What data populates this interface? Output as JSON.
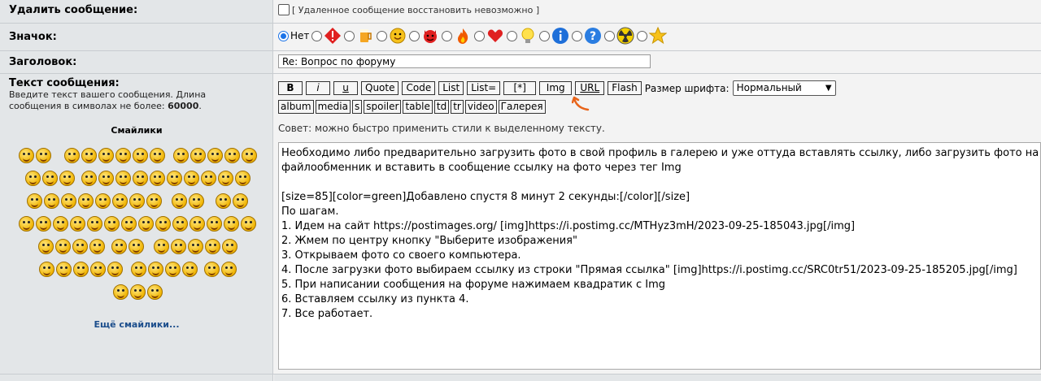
{
  "delete": {
    "label": "Удалить сообщение:",
    "note": "[ Удаленное сообщение восстановить невозможно ]"
  },
  "icon": {
    "label": "Значок:",
    "none_label": "Нет",
    "options": [
      "warning-icon",
      "beer-icon",
      "smile-icon",
      "devil-icon",
      "fire-icon",
      "heart-icon",
      "lightbulb-icon",
      "info-icon",
      "question-icon",
      "radioactive-icon",
      "star-icon"
    ]
  },
  "title": {
    "label": "Заголовок:",
    "value": "Re: Вопрос по форуму"
  },
  "message": {
    "label": "Текст сообщения:",
    "hint_prefix": "Введите текст вашего сообщения. Длина сообщения в символах не более: ",
    "hint_limit": "60000",
    "hint_suffix": ".",
    "smiles_title": "Смайлики",
    "more_smiles": "Ещё смайлики..."
  },
  "toolbar": {
    "row1": [
      "B",
      "i",
      "u",
      "Quote",
      "Code",
      "List",
      "List=",
      "[*]",
      "Img",
      "URL",
      "Flash"
    ],
    "font_size_label": "Размер шрифта:",
    "font_size_value": "Нормальный",
    "row2": [
      "album",
      "media",
      "s",
      "spoiler",
      "table",
      "td",
      "tr",
      "video",
      "Галерея"
    ]
  },
  "tip": "Совет: можно быстро применить стили к выделенному тексту.",
  "body_text": "Необходимо либо предварительно загрузить фото в свой профиль в галерею и уже оттуда вставлять ссылку, либо загрузить фото на л\nфайлообменник и вставить в сообщение ссылку на фото через тег Img\n\n[size=85][color=green]Добавлено спустя 8 минут 2 секунды:[/color][/size]\nПо шагам.\n1. Идем на сайт https://postimages.org/ [img]https://i.postimg.cc/MTHyz3mH/2023-09-25-185043.jpg[/img]\n2. Жмем по центру кнопку \"Выберите изображения\"\n3. Открываем фото со своего компьютера.\n4. После загрузки фото выбираем ссылку из строки \"Прямая ссылка\" [img]https://i.postimg.cc/SRC0tr51/2023-09-25-185205.jpg[/img]\n5. При написании сообщения на форуме нажимаем квадратик с Img\n6. Вставляем ссылку из пункта 4.\n7. Все работает.",
  "colors": {
    "left_bg": "#e3e6e8",
    "right_bg": "#f3f3f3",
    "accent": "#1a73e8",
    "annotation": "#e8641a"
  }
}
